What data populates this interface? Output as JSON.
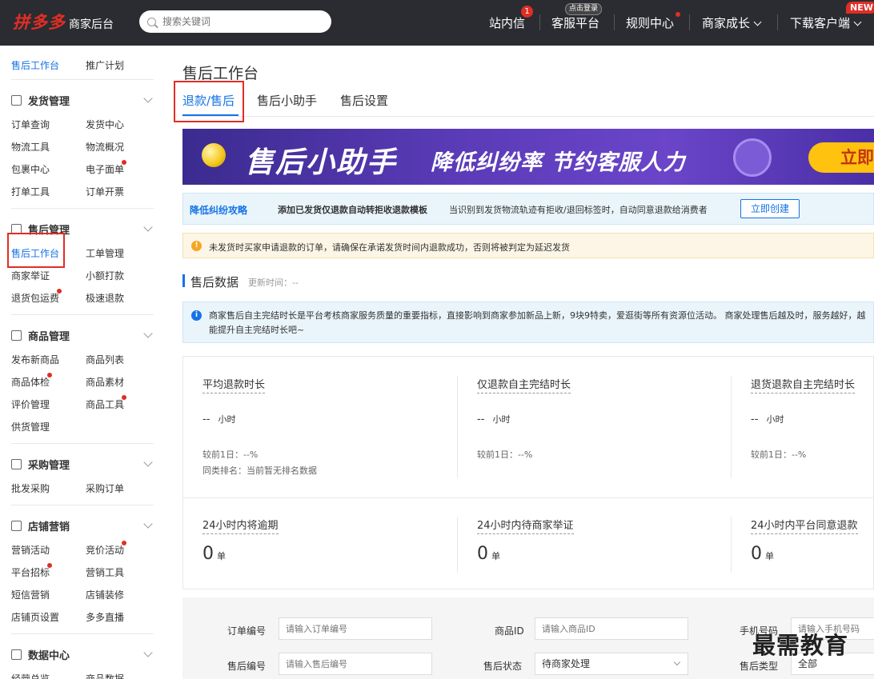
{
  "header": {
    "logo": "拼多多",
    "logo_sub": "商家后台",
    "search_placeholder": "搜索关键词",
    "nav": [
      {
        "label": "站内信",
        "badge": "1"
      },
      {
        "label": "客服平台",
        "badge": "点击登录"
      },
      {
        "label": "规则中心"
      },
      {
        "label": "商家成长"
      },
      {
        "label": "下载客户端",
        "badge": "NEW"
      }
    ]
  },
  "sidebar": {
    "top_links": [
      "售后工作台",
      "推广计划"
    ],
    "groups": [
      {
        "title": "发货管理",
        "items": [
          "订单查询",
          "发货中心",
          "物流工具",
          "物流概况",
          "包裹中心",
          "电子面单",
          "打单工具",
          "订单开票"
        ]
      },
      {
        "title": "售后管理",
        "items": [
          "售后工作台",
          "工单管理",
          "商家举证",
          "小额打款",
          "退货包运费",
          "极速退款"
        ]
      },
      {
        "title": "商品管理",
        "items": [
          "发布新商品",
          "商品列表",
          "商品体检",
          "商品素材",
          "评价管理",
          "商品工具",
          "供货管理"
        ]
      },
      {
        "title": "采购管理",
        "items": [
          "批发采购",
          "采购订单"
        ]
      },
      {
        "title": "店铺营销",
        "items": [
          "营销活动",
          "竞价活动",
          "平台招标",
          "营销工具",
          "短信营销",
          "店铺装修",
          "店铺页设置",
          "多多直播"
        ]
      },
      {
        "title": "数据中心",
        "items": [
          "经营总览",
          "商品数据"
        ]
      }
    ]
  },
  "main": {
    "title": "售后工作台",
    "tabs": [
      "退款/售后",
      "售后小助手",
      "售后设置"
    ],
    "banner": {
      "title": "售后小助手",
      "subtitle": "降低纠纷率 节约客服人力",
      "cta": "立即"
    },
    "tip": {
      "strong": "降低纠纷攻略",
      "bold": "添加已发货仅退款自动转拒收退款模板",
      "text": "当识别到发货物流轨迹有拒收/退回标签时，自动同意退款给消费者",
      "button": "立即创建"
    },
    "warning": "未发货时买家申请退款的订单，请确保在承诺发货时间内退款成功，否则将被判定为延迟发货",
    "section": {
      "title": "售后数据",
      "updated": "更新时间：--"
    },
    "info": "商家售后自主完结时长是平台考核商家服务质量的重要指标，直接影响到商家参加新品上新，9块9特卖，爱逛街等所有资源位活动。 商家处理售后越及时，服务越好，越能提升自主完结时长吧~",
    "stats_row1": [
      {
        "label": "平均退款时长",
        "value": "-- ",
        "unit": "小时",
        "compare": "较前1日：--%",
        "rank": "同类排名：当前暂无排名数据"
      },
      {
        "label": "仅退款自主完结时长",
        "value": "-- ",
        "unit": "小时",
        "compare": "较前1日：--%"
      },
      {
        "label": "退货退款自主完结时长",
        "value": "-- ",
        "unit": "小时",
        "compare": "较前1日：--%"
      }
    ],
    "stats_row2": [
      {
        "label": "24小时内将逾期",
        "value": "0",
        "unit": "单"
      },
      {
        "label": "24小时内待商家举证",
        "value": "0",
        "unit": "单"
      },
      {
        "label": "24小时内平台同意退款",
        "value": "0",
        "unit": "单"
      }
    ],
    "filters": {
      "order_no_label": "订单编号",
      "order_no_placeholder": "请输入订单编号",
      "goods_id_label": "商品ID",
      "goods_id_placeholder": "请输入商品ID",
      "phone_label": "手机号码",
      "phone_placeholder": "请输入手机号码",
      "aftersale_no_label": "售后编号",
      "aftersale_no_placeholder": "请输入售后编号",
      "status_label": "售后状态",
      "status_value": "待商家处理",
      "type_label": "售后类型",
      "type_value": "全部"
    }
  },
  "watermark": "最需教育",
  "colors": {
    "brand": "#e02e24",
    "accent": "#1473e6",
    "topbar": "#2b2c31"
  }
}
